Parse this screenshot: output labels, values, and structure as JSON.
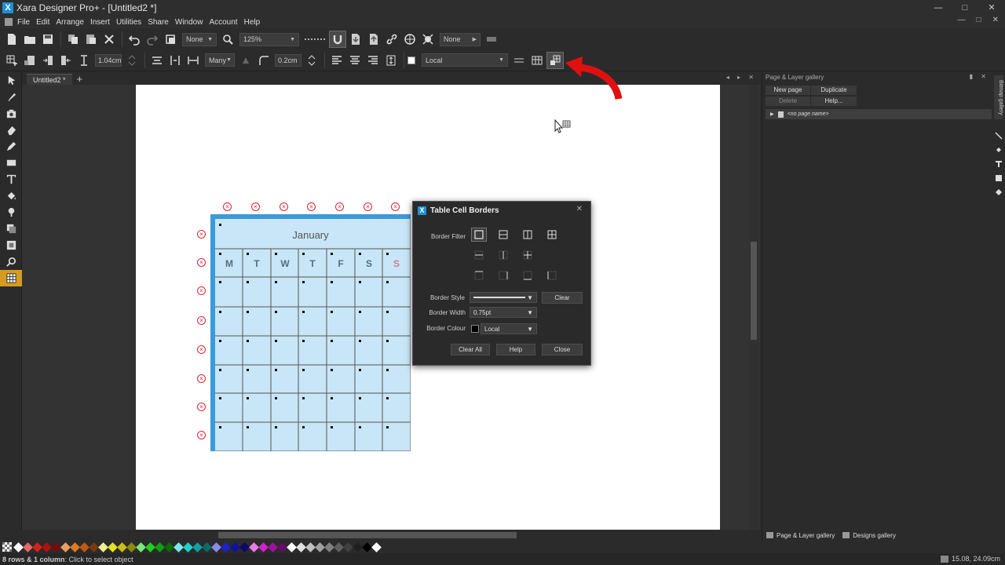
{
  "window": {
    "title": "Xara Designer Pro+ - [Untitled2 *]",
    "min": "—",
    "max": "□",
    "close": "✕"
  },
  "menu": {
    "items": [
      "File",
      "Edit",
      "Arrange",
      "Insert",
      "Utilities",
      "Share",
      "Window",
      "Account",
      "Help"
    ],
    "right_min": "—",
    "right_max": "□",
    "right_close": "✕"
  },
  "toolbar1": {
    "quality_combo": "None",
    "zoom_combo": "125%",
    "snap_combo": "None"
  },
  "toolbar2": {
    "width_field": "1.04cm",
    "spacing_combo": "Many",
    "corner_field": "0.2cm",
    "fill_combo": "Local"
  },
  "document": {
    "tab_name": "Untitled2 *",
    "tab_add": "+",
    "tab_tools": "◂ ▸ ✕"
  },
  "calendar": {
    "title": "January",
    "days": [
      "M",
      "T",
      "W",
      "T",
      "F",
      "S",
      "S"
    ]
  },
  "dialog": {
    "title": "Table Cell Borders",
    "close": "✕",
    "border_filter_label": "Border Filter",
    "border_style_label": "Border Style",
    "border_width_label": "Border Width",
    "border_colour_label": "Border Colour",
    "border_width_value": "0.75pt",
    "border_colour_value": "Local",
    "clear_button": "Clear",
    "clear_all_button": "Clear All",
    "help_button": "Help",
    "close_button": "Close"
  },
  "right_panel": {
    "title": "Page & Layer gallery",
    "tools": "▮ ✕",
    "new_page": "New page",
    "duplicate": "Duplicate",
    "delete": "Delete",
    "help": "Help...",
    "page_row": "<no page name>",
    "tabs": [
      "Page & Layer gallery",
      "Designs gallery"
    ],
    "strip_label": "Bitmap gallery"
  },
  "palette": {
    "colors": [
      "#ffffff",
      "#e06a6a",
      "#d81e1e",
      "#b01010",
      "#7a0a0a",
      "#e8a060",
      "#e07a20",
      "#c05a10",
      "#7a3a10",
      "#f0f090",
      "#e8e020",
      "#c8c010",
      "#8a8a10",
      "#7ae87a",
      "#20d020",
      "#10a010",
      "#0a6a0a",
      "#7ae8e8",
      "#20d0d0",
      "#10a0a0",
      "#0a6a6a",
      "#8a8ae8",
      "#2020d0",
      "#1010a0",
      "#0a0a6a",
      "#e87ae8",
      "#d020d0",
      "#a010a0",
      "#6a0a6a",
      "#ffffff",
      "#e0e0e0",
      "#c0c0c0",
      "#a0a0a0",
      "#808080",
      "#606060",
      "#404040",
      "#202020",
      "#000000",
      "#ffffff"
    ]
  },
  "status": {
    "left_bold": "8 rows & 1 column",
    "left_rest": " : Click to select object",
    "coords": "15.08, 24.09cm"
  },
  "colors": {
    "accent_tool": "#d79b1e",
    "table_fill": "#c8e6f7",
    "table_border": "#3c9ad8",
    "arrow_red": "#e01010"
  }
}
